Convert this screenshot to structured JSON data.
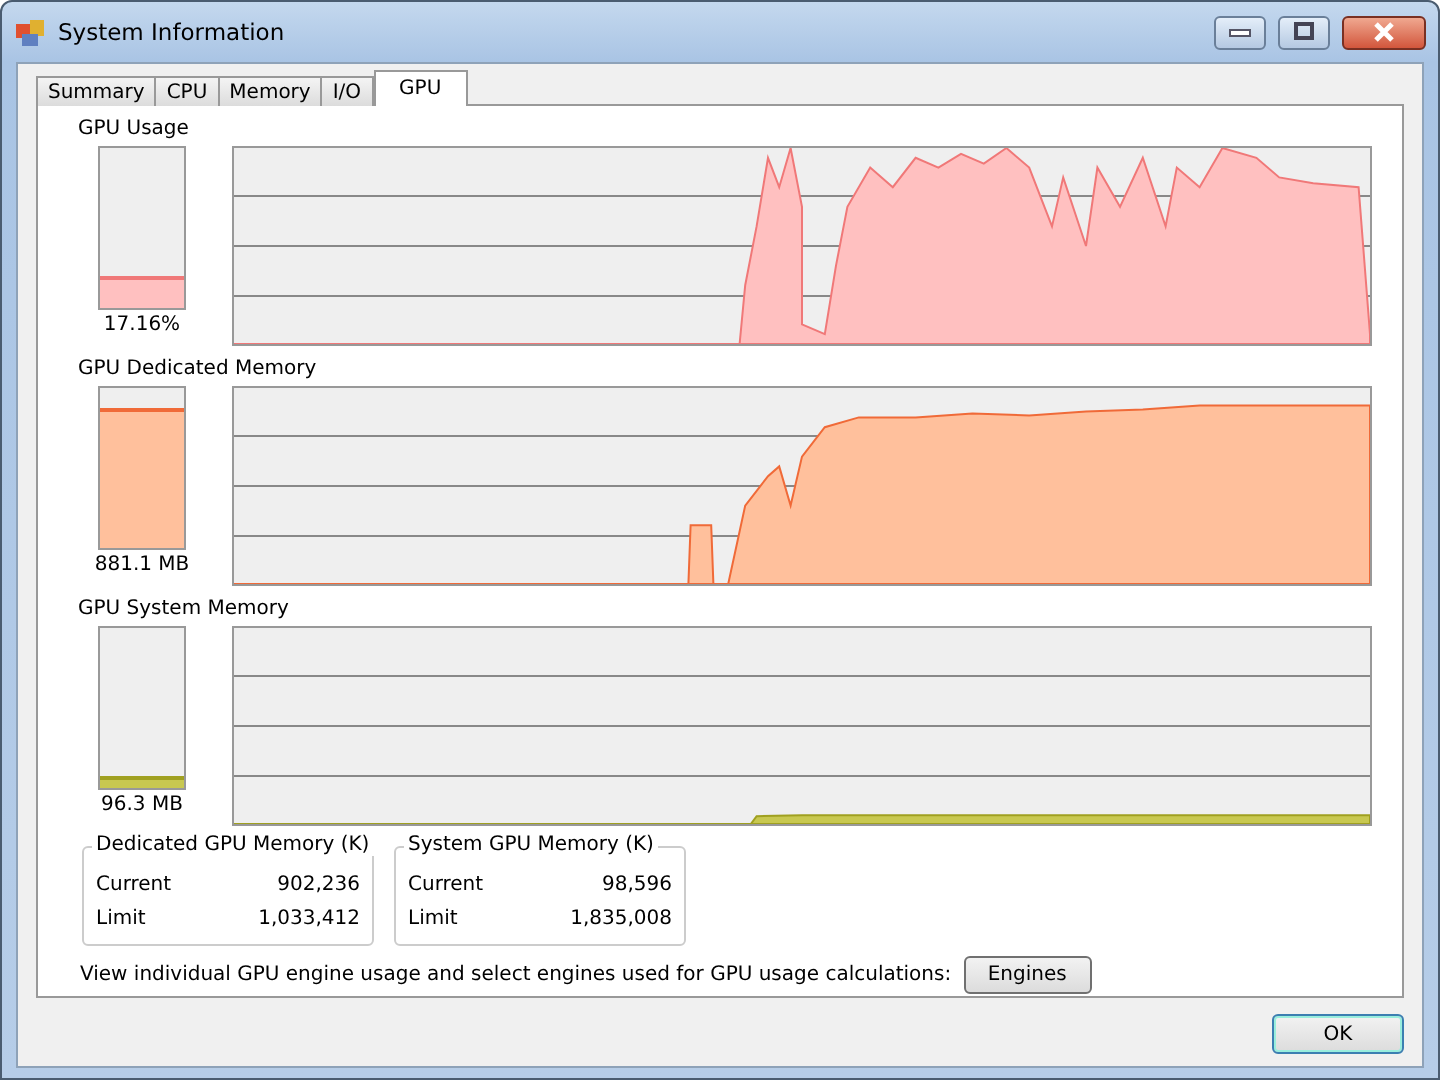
{
  "window": {
    "title": "System Information"
  },
  "tabs": [
    {
      "label": "Summary",
      "selected": false
    },
    {
      "label": "CPU",
      "selected": false
    },
    {
      "label": "Memory",
      "selected": false
    },
    {
      "label": "I/O",
      "selected": false
    },
    {
      "label": "GPU",
      "selected": true
    }
  ],
  "graphs": [
    {
      "kind": "usage",
      "title": "GPU Usage",
      "level": 0.17,
      "reading": "17.16%"
    },
    {
      "kind": "dedicated",
      "title": "GPU Dedicated Memory",
      "level": 0.85,
      "reading": "881.1 MB"
    },
    {
      "kind": "system",
      "title": "GPU System Memory",
      "level": 0.05,
      "reading": "96.3 MB"
    }
  ],
  "memory_groups": [
    {
      "title": "Dedicated GPU Memory (K)",
      "rows": [
        {
          "label": "Current",
          "value": "902,236"
        },
        {
          "label": "Limit",
          "value": "1,033,412"
        }
      ]
    },
    {
      "title": "System GPU Memory (K)",
      "rows": [
        {
          "label": "Current",
          "value": "98,596"
        },
        {
          "label": "Limit",
          "value": "1,835,008"
        }
      ]
    }
  ],
  "engines": {
    "text": "View individual GPU engine usage and select engines used for GPU usage calculations:",
    "button": "Engines"
  },
  "ok_button": "OK"
}
